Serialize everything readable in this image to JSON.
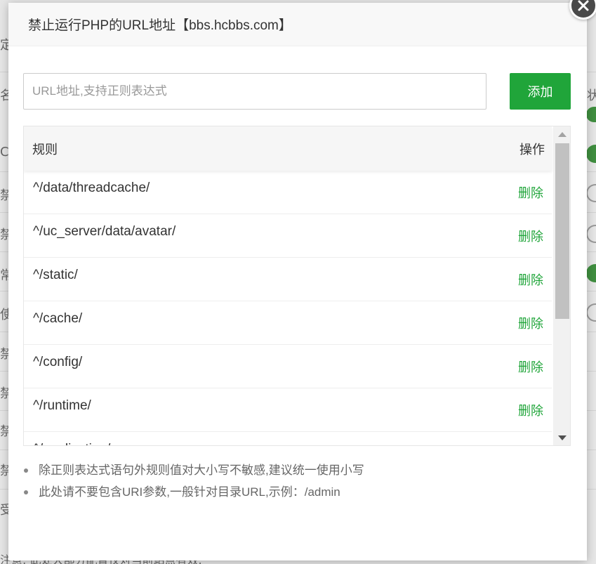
{
  "background": {
    "glyphs": [
      "定",
      "名",
      "Co",
      "禁",
      "禁",
      "常",
      "使",
      "禁",
      "禁",
      "禁",
      "禁",
      "受"
    ],
    "right_glyph": "状",
    "footer_note": "注意: 此处大部分配置仅对当前站点有效."
  },
  "dialog": {
    "title": "禁止运行PHP的URL地址【bbs.hcbbs.com】",
    "close_icon": "close-icon",
    "input_placeholder": "URL地址,支持正则表达式",
    "input_value": "",
    "add_label": "添加",
    "accent_color": "#20a53a"
  },
  "table": {
    "headers": {
      "rule": "规则",
      "action": "操作"
    },
    "rows": [
      {
        "rule": "^/data/threadcache/",
        "action": "删除"
      },
      {
        "rule": "^/uc_server/data/avatar/",
        "action": "删除"
      },
      {
        "rule": "^/static/",
        "action": "删除"
      },
      {
        "rule": "^/cache/",
        "action": "删除"
      },
      {
        "rule": "^/config/",
        "action": "删除"
      },
      {
        "rule": "^/runtime/",
        "action": "删除"
      },
      {
        "rule": "^/application/",
        "action": "删除"
      }
    ]
  },
  "notes": [
    "除正则表达式语句外规则值对大小写不敏感,建议统一使用小写",
    "此处请不要包含URI参数,一般针对目录URL,示例：/admin"
  ]
}
